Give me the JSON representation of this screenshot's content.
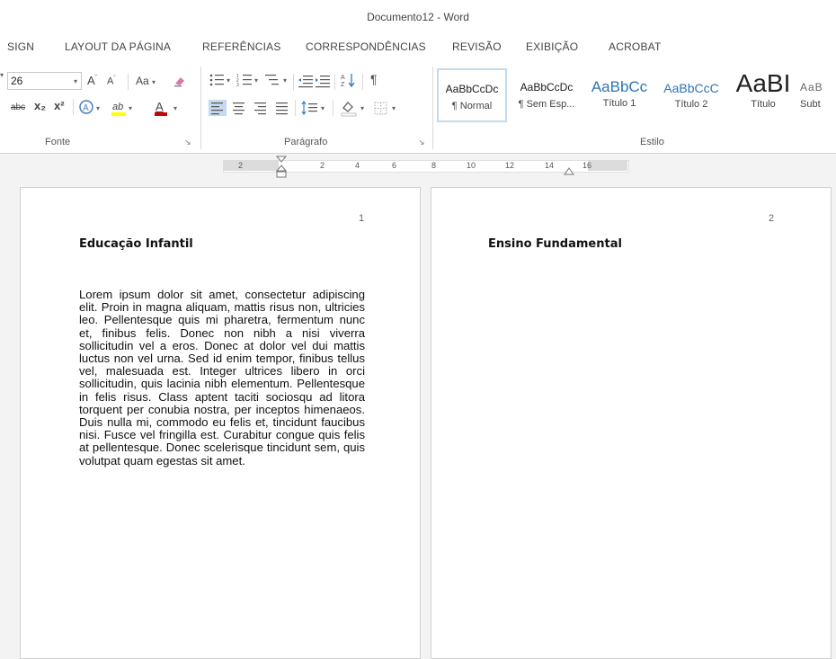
{
  "window": {
    "title": "Documento12 - Word"
  },
  "menu": {
    "items": [
      "SIGN",
      "LAYOUT DA PÁGINA",
      "REFERÊNCIAS",
      "CORRESPONDÊNCIAS",
      "REVISÃO",
      "EXIBIÇÃO",
      "ACROBAT"
    ]
  },
  "font_group": {
    "size": "26",
    "change_case": "Aa",
    "label": "Fonte",
    "strike": "abc",
    "subscript": "x₂",
    "superscript": "x²",
    "text_color": "A"
  },
  "paragraph_group": {
    "label": "Parágrafo"
  },
  "styles_group": {
    "label": "Estilo",
    "styles": [
      {
        "preview": "AaBbCcDc",
        "name": "¶ Normal"
      },
      {
        "preview": "AaBbCcDc",
        "name": "¶ Sem Esp..."
      },
      {
        "preview": "AaBbCc",
        "name": "Título 1"
      },
      {
        "preview": "AaBbCcC",
        "name": "Título 2"
      },
      {
        "preview": "AaBI",
        "name": "Título"
      },
      {
        "preview": "AaB",
        "name": "Subt"
      }
    ]
  },
  "ruler": {
    "ticks": [
      "2",
      "2",
      "4",
      "6",
      "8",
      "10",
      "12",
      "14",
      "16"
    ]
  },
  "pages": [
    {
      "number": "1",
      "heading": "Educação Infantil",
      "body": "Lorem ipsum dolor sit amet, consectetur adipiscing elit. Proin in magna aliquam, mattis risus non, ultricies leo. Pellentesque quis mi pharetra, fermentum nunc et, finibus felis. Donec non nibh a nisi viverra sollicitudin vel a eros. Donec at dolor vel dui mattis luctus non vel urna. Sed id enim tempor, finibus tellus vel, malesuada est. Integer ultrices libero in orci sollicitudin, quis lacinia nibh elementum. Pellentesque in felis risus. Class aptent taciti sociosqu ad litora torquent per conubia nostra, per inceptos himenaeos. Duis nulla mi, commodo eu felis et, tincidunt faucibus nisi. Fusce vel fringilla est. Curabitur congue quis felis at pellentesque. Donec scelerisque tincidunt sem, quis volutpat quam egestas sit amet."
    },
    {
      "number": "2",
      "heading": "Ensino Fundamental"
    }
  ],
  "colors": {
    "highlight": "#ffff00",
    "font_red": "#d00000",
    "style_blue": "#2e74b5",
    "selected": "#c5d9ef"
  }
}
